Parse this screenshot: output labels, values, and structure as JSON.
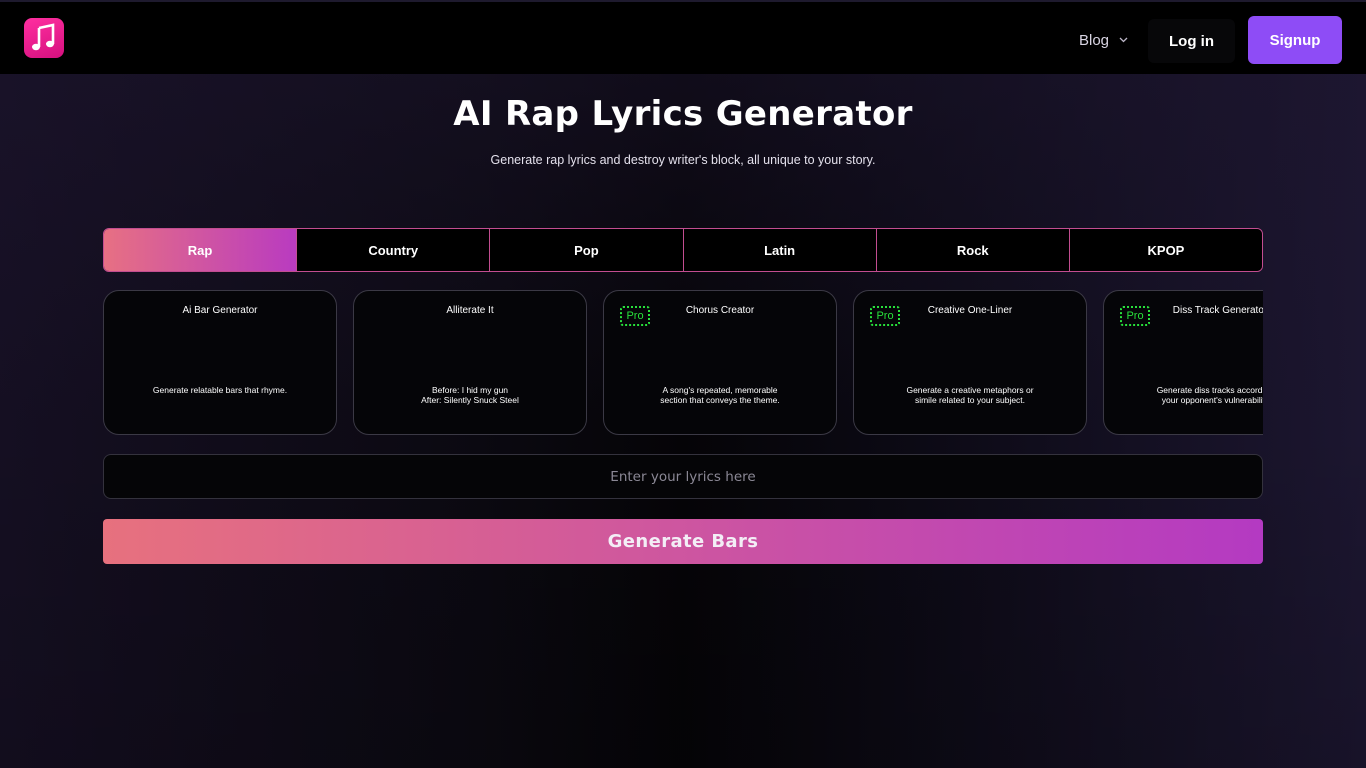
{
  "header": {
    "logo_icon": "music-note-icon",
    "nav": {
      "blog_label": "Blog",
      "login_label": "Log in",
      "signup_label": "Signup"
    }
  },
  "hero": {
    "title": "AI Rap Lyrics Generator",
    "subtitle": "Generate rap lyrics and destroy writer's block, all unique to your story."
  },
  "genres": [
    "Rap",
    "Country",
    "Pop",
    "Latin",
    "Rock",
    "KPOP"
  ],
  "selected_genre": "Rap",
  "tools": [
    {
      "title": "Ai Bar Generator",
      "pro": false,
      "desc": [
        "Generate relatable bars that rhyme."
      ]
    },
    {
      "title": "Alliterate It",
      "pro": false,
      "desc": [
        "Before: I hid my gun",
        "After: Silently Snuck Steel"
      ]
    },
    {
      "title": "Chorus Creator",
      "pro": true,
      "desc": [
        "A song's repeated, memorable",
        "section that conveys the theme."
      ]
    },
    {
      "title": "Creative One-Liner",
      "pro": true,
      "desc": [
        "Generate a creative metaphors or",
        "simile related to your subject."
      ]
    },
    {
      "title": "Diss Track Generator",
      "pro": true,
      "desc": [
        "Generate diss tracks according to",
        "your opponent's vulnerabilities."
      ]
    }
  ],
  "pro_label": "Pro",
  "lyrics_input": {
    "placeholder": "Enter your lyrics here",
    "value": ""
  },
  "generate_label": "Generate Bars",
  "colors": {
    "accent_purple": "#8e4cf6",
    "gradient_start": "#e7717e",
    "gradient_end": "#b43ac2",
    "pro_green": "#28e03b",
    "logo_pink": "#ff2fa0"
  }
}
